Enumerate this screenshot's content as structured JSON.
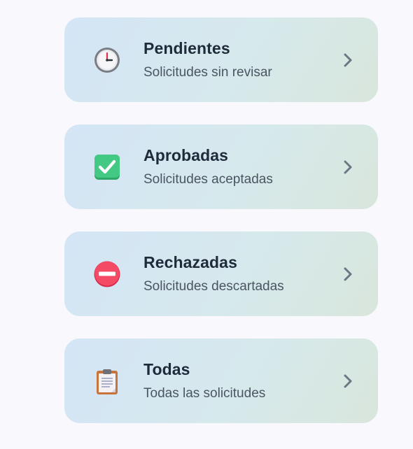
{
  "categories": [
    {
      "title": "Pendientes",
      "subtitle": "Solicitudes sin revisar",
      "icon": "clock-icon"
    },
    {
      "title": "Aprobadas",
      "subtitle": "Solicitudes aceptadas",
      "icon": "check-mark-button-icon"
    },
    {
      "title": "Rechazadas",
      "subtitle": "Solicitudes descartadas",
      "icon": "no-entry-icon"
    },
    {
      "title": "Todas",
      "subtitle": "Todas las solicitudes",
      "icon": "clipboard-icon"
    }
  ],
  "chevron_icon": "chevron-right-icon",
  "colors": {
    "page_background": "#f8f8fd",
    "card_gradient_start": "#d4e5f6",
    "card_gradient_end": "#d8e6dc",
    "title_text": "#1f2b3b",
    "subtitle_text": "#4a5561",
    "chevron": "#6b7682",
    "check_green": "#3cc47a",
    "no_entry_red": "#f0405f"
  }
}
